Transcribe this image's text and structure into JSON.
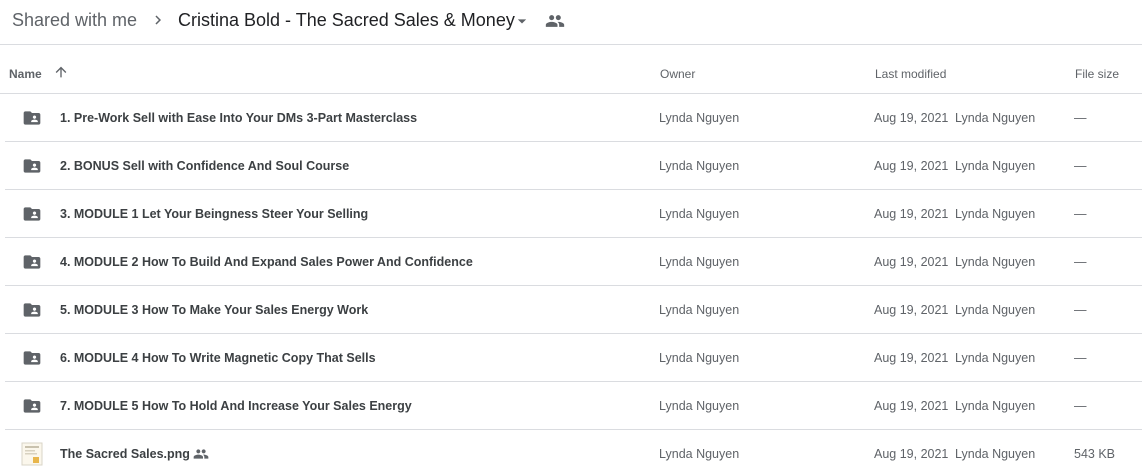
{
  "breadcrumb": {
    "root": "Shared with me",
    "current": "Cristina Bold - The Sacred Sales & Money"
  },
  "columns": {
    "name": "Name",
    "owner": "Owner",
    "last_modified": "Last modified",
    "file_size": "File size"
  },
  "icons": {
    "separator": "chevron-right-icon",
    "caret": "caret-down-icon",
    "shared": "shared-people-icon",
    "sort": "arrow-up-icon",
    "folder": "shared-folder-icon",
    "image": "image-file-icon"
  },
  "colors": {
    "folder": "#5f6368",
    "divider": "#dadce0",
    "text": "#3c4043"
  },
  "files": [
    {
      "name": "1. Pre-Work Sell with Ease Into Your DMs 3-Part Masterclass",
      "owner": "Lynda Nguyen",
      "modified": "Aug 19, 2021",
      "modified_by": "Lynda Nguyen",
      "size": "—",
      "type": "folder"
    },
    {
      "name": "2. BONUS Sell with Confidence And Soul Course",
      "owner": "Lynda Nguyen",
      "modified": "Aug 19, 2021",
      "modified_by": "Lynda Nguyen",
      "size": "—",
      "type": "folder"
    },
    {
      "name": "3. MODULE 1 Let Your Beingness Steer Your Selling",
      "owner": "Lynda Nguyen",
      "modified": "Aug 19, 2021",
      "modified_by": "Lynda Nguyen",
      "size": "—",
      "type": "folder"
    },
    {
      "name": "4. MODULE 2 How To Build And Expand Sales Power And Confidence",
      "owner": "Lynda Nguyen",
      "modified": "Aug 19, 2021",
      "modified_by": "Lynda Nguyen",
      "size": "—",
      "type": "folder"
    },
    {
      "name": "5. MODULE 3 How To Make Your Sales Energy Work",
      "owner": "Lynda Nguyen",
      "modified": "Aug 19, 2021",
      "modified_by": "Lynda Nguyen",
      "size": "—",
      "type": "folder"
    },
    {
      "name": "6. MODULE 4 How To Write Magnetic Copy That Sells",
      "owner": "Lynda Nguyen",
      "modified": "Aug 19, 2021",
      "modified_by": "Lynda Nguyen",
      "size": "—",
      "type": "folder"
    },
    {
      "name": "7. MODULE 5 How To Hold And Increase Your Sales Energy",
      "owner": "Lynda Nguyen",
      "modified": "Aug 19, 2021",
      "modified_by": "Lynda Nguyen",
      "size": "—",
      "type": "folder"
    },
    {
      "name": "The Sacred Sales.png",
      "owner": "Lynda Nguyen",
      "modified": "Aug 19, 2021",
      "modified_by": "Lynda Nguyen",
      "size": "543 KB",
      "type": "image",
      "shared": true
    }
  ]
}
